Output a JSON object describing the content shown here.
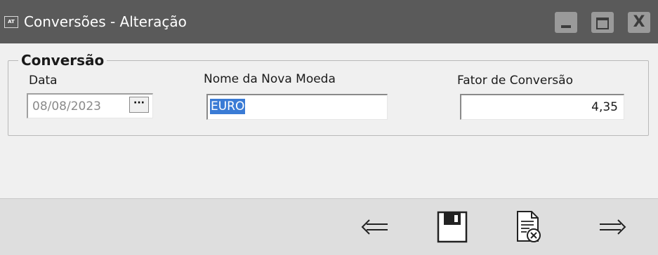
{
  "window": {
    "title": "Conversões - Alteração",
    "app_icon_text": "AT",
    "close_glyph": "X"
  },
  "group": {
    "legend": "Conversão"
  },
  "fields": {
    "data": {
      "label": "Data",
      "value": "08/08/2023",
      "button_label": "···"
    },
    "nome": {
      "label": "Nome da Nova Moeda",
      "value": "EURO"
    },
    "fator": {
      "label": "Fator de Conversão",
      "value": "4,35"
    }
  },
  "toolbar": {
    "icons": [
      "arrow-left-icon",
      "save-icon",
      "cancel-document-icon",
      "arrow-right-icon"
    ]
  },
  "colors": {
    "titlebar": "#5a5a5a",
    "selection": "#3a7bd5",
    "toolbar": "#dedede"
  }
}
